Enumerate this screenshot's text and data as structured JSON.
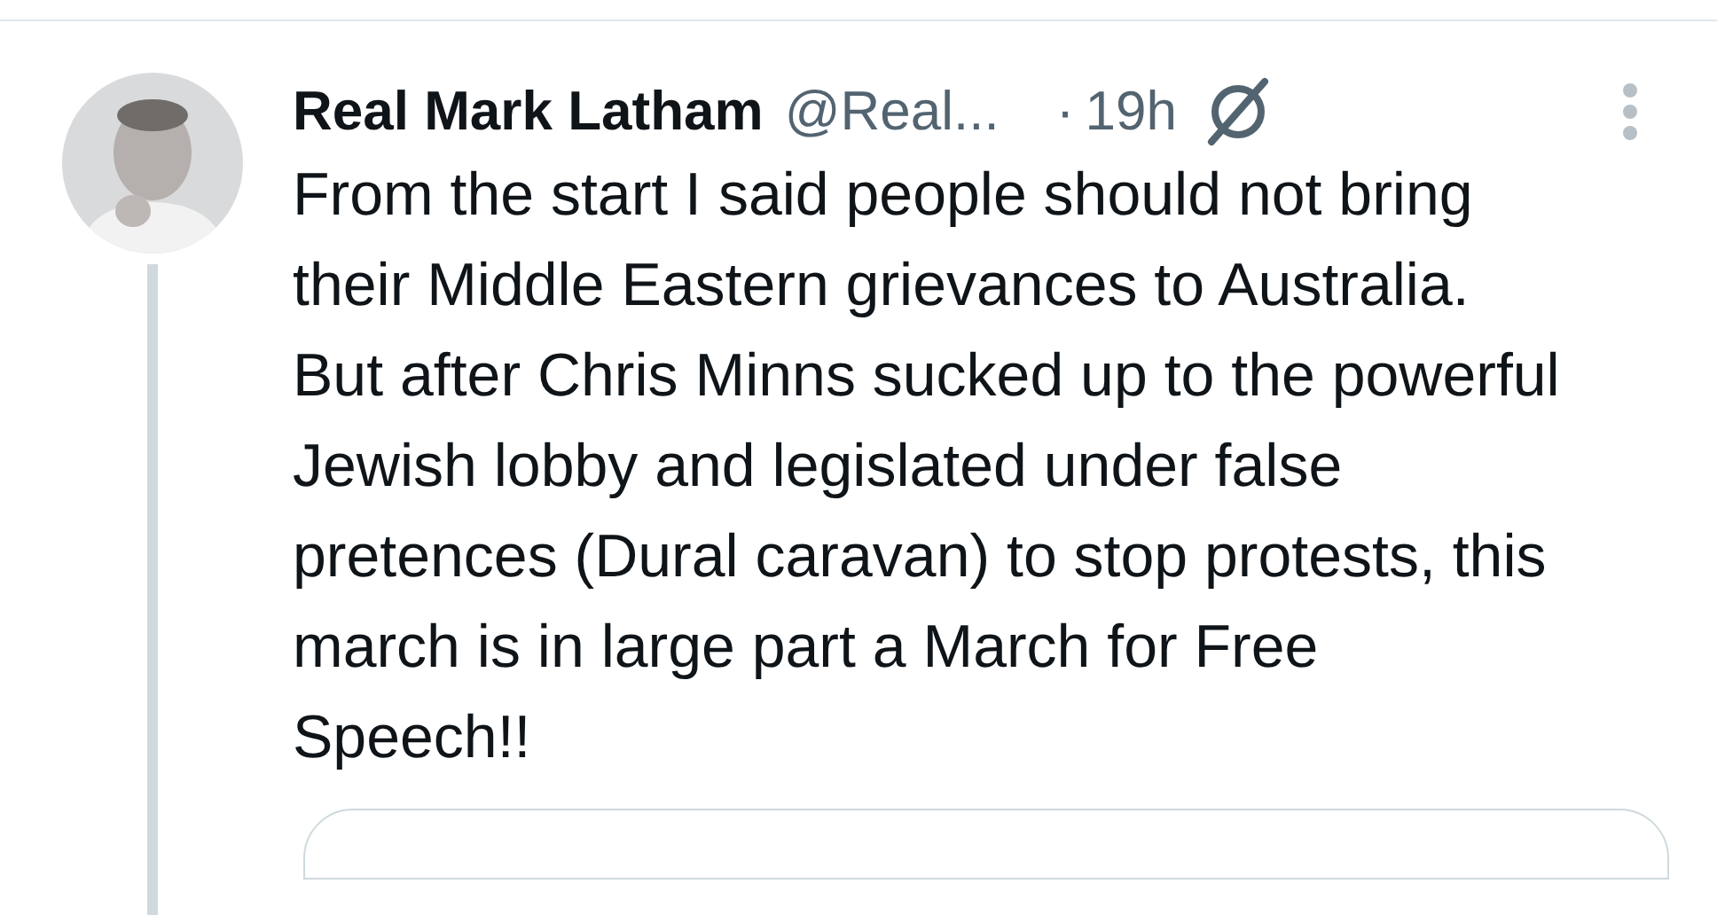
{
  "tweet": {
    "author_name": "Real Mark Latham",
    "handle": "@Real...",
    "separator": "·",
    "time": "19h",
    "paragraphs": [
      "From the start I said people should not bring their Middle Eastern grievances to Australia.",
      "But after Chris Minns sucked up to the powerful Jewish lobby and legislated under false pretences (Dural caravan) to stop protests, this march is in large part a March for Free Speech!!"
    ]
  }
}
